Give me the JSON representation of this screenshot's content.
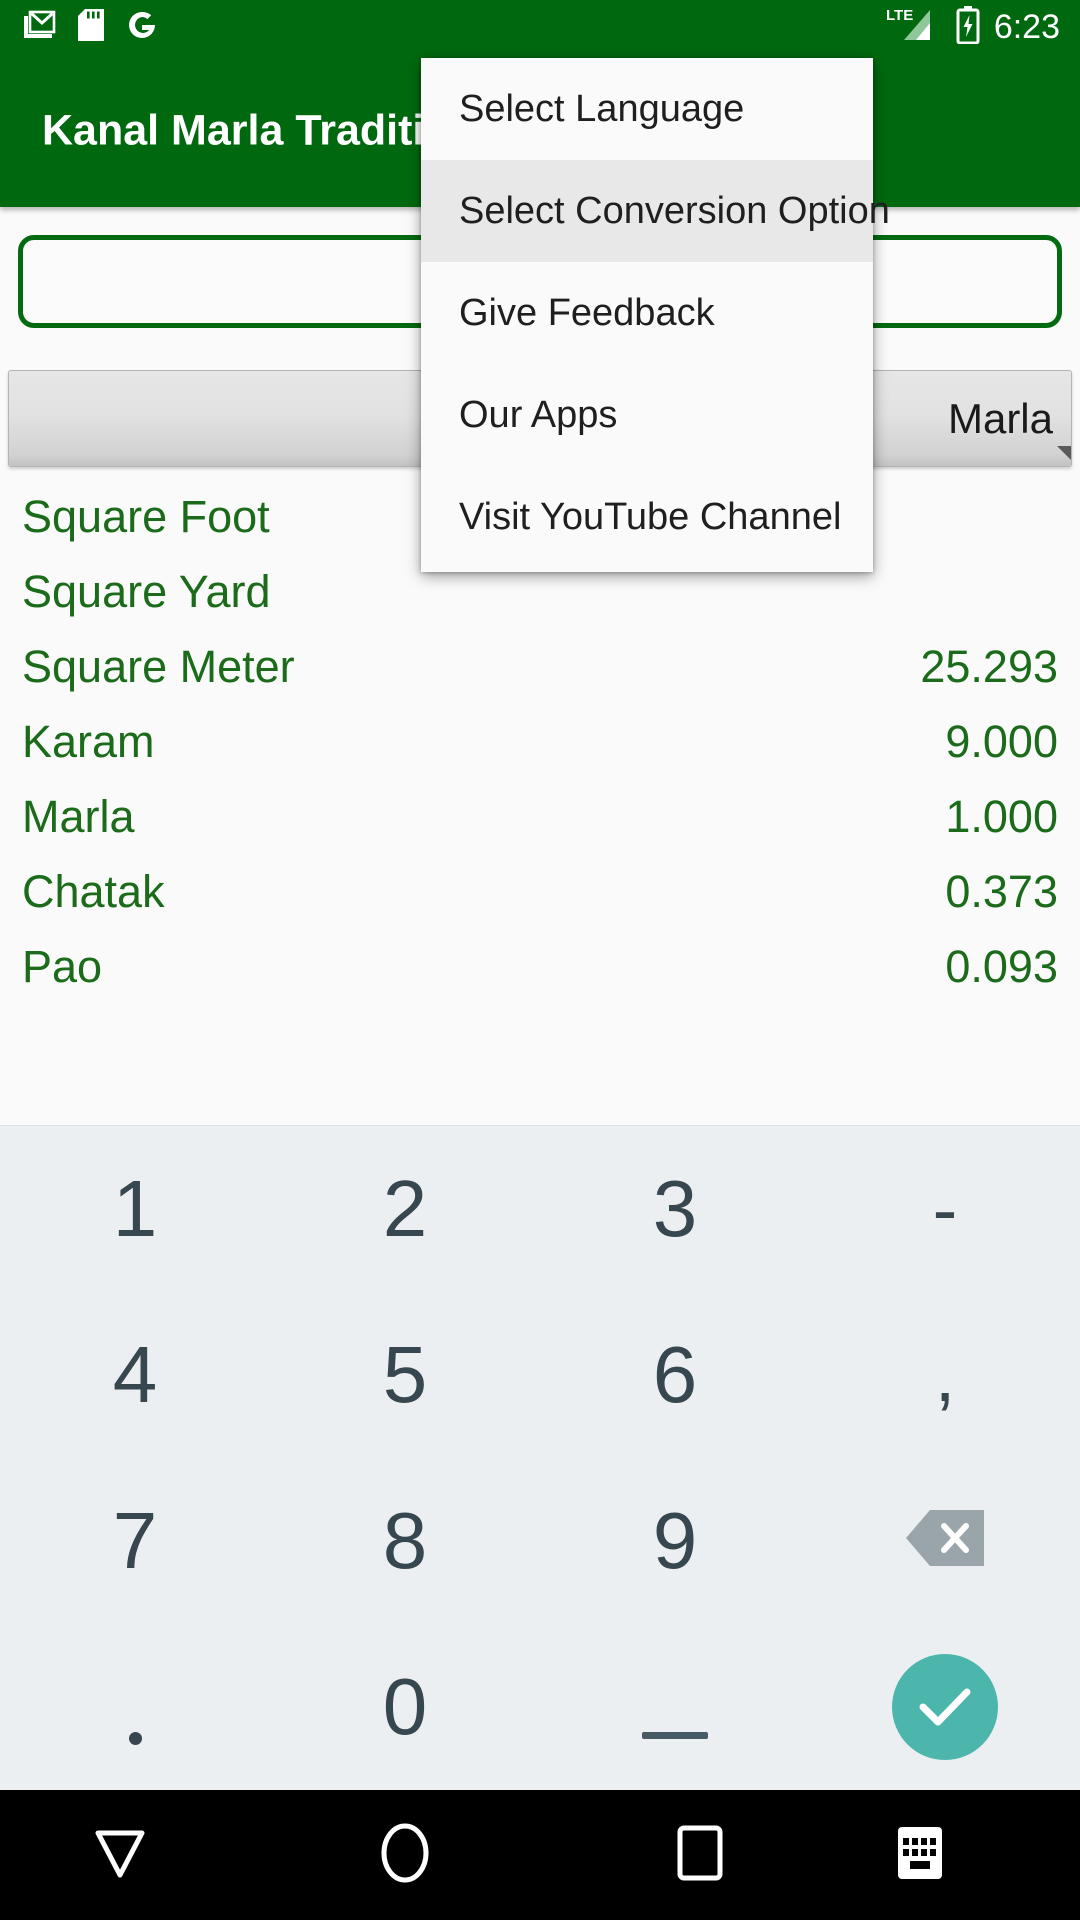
{
  "statusbar": {
    "icons": [
      "gmail-icon",
      "sd-card-icon",
      "google-icon"
    ],
    "network_label": "LTE",
    "signal_icon": "signal-bars-icon",
    "battery_icon": "battery-charging-icon",
    "time": "6:23"
  },
  "actionbar": {
    "title": "Kanal Marla Traditional",
    "background_color": "#00690F",
    "title_color": "#FFFFFF"
  },
  "input": {
    "value": "",
    "placeholder": "",
    "border_color": "#046A10"
  },
  "spinner": {
    "selected": "Marla",
    "dropdown_icon": "spinner-caret-icon"
  },
  "conversions": {
    "accent_color": "#1B6B1B",
    "rows": [
      {
        "name": "Square Foot",
        "value": ""
      },
      {
        "name": "Square Yard",
        "value": ""
      },
      {
        "name": "Square Meter",
        "value": "25.293"
      },
      {
        "name": "Karam",
        "value": "9.000"
      },
      {
        "name": "Marla",
        "value": "1.000"
      },
      {
        "name": "Chatak",
        "value": "0.373"
      },
      {
        "name": "Pao",
        "value": "0.093"
      }
    ]
  },
  "overflow_menu": {
    "items": [
      {
        "label": "Select Language",
        "selected": false
      },
      {
        "label": "Select Conversion Option",
        "selected": true
      },
      {
        "label": "Give Feedback",
        "selected": false
      },
      {
        "label": "Our Apps",
        "selected": false
      },
      {
        "label": "Visit YouTube Channel",
        "selected": false
      }
    ]
  },
  "keyboard": {
    "rows": [
      [
        {
          "label": "1",
          "kind": "digit"
        },
        {
          "label": "2",
          "kind": "digit"
        },
        {
          "label": "3",
          "kind": "digit"
        },
        {
          "label": "-",
          "kind": "symbol"
        }
      ],
      [
        {
          "label": "4",
          "kind": "digit"
        },
        {
          "label": "5",
          "kind": "digit"
        },
        {
          "label": "6",
          "kind": "digit"
        },
        {
          "label": ",",
          "kind": "symbol"
        }
      ],
      [
        {
          "label": "7",
          "kind": "digit"
        },
        {
          "label": "8",
          "kind": "digit"
        },
        {
          "label": "9",
          "kind": "digit"
        },
        {
          "label": "",
          "kind": "backspace"
        }
      ],
      [
        {
          "label": ".",
          "kind": "period"
        },
        {
          "label": "0",
          "kind": "digit"
        },
        {
          "label": "_",
          "kind": "underscore"
        },
        {
          "label": "",
          "kind": "enter"
        }
      ]
    ],
    "background_color": "#ECEFF1",
    "key_color": "#37474F",
    "enter_color": "#4DB6AC"
  },
  "navbar": {
    "buttons": [
      {
        "icon": "back-triangle-icon"
      },
      {
        "icon": "home-circle-icon"
      },
      {
        "icon": "recents-square-icon"
      },
      {
        "icon": "keyboard-switch-icon"
      }
    ],
    "background_color": "#000000"
  }
}
